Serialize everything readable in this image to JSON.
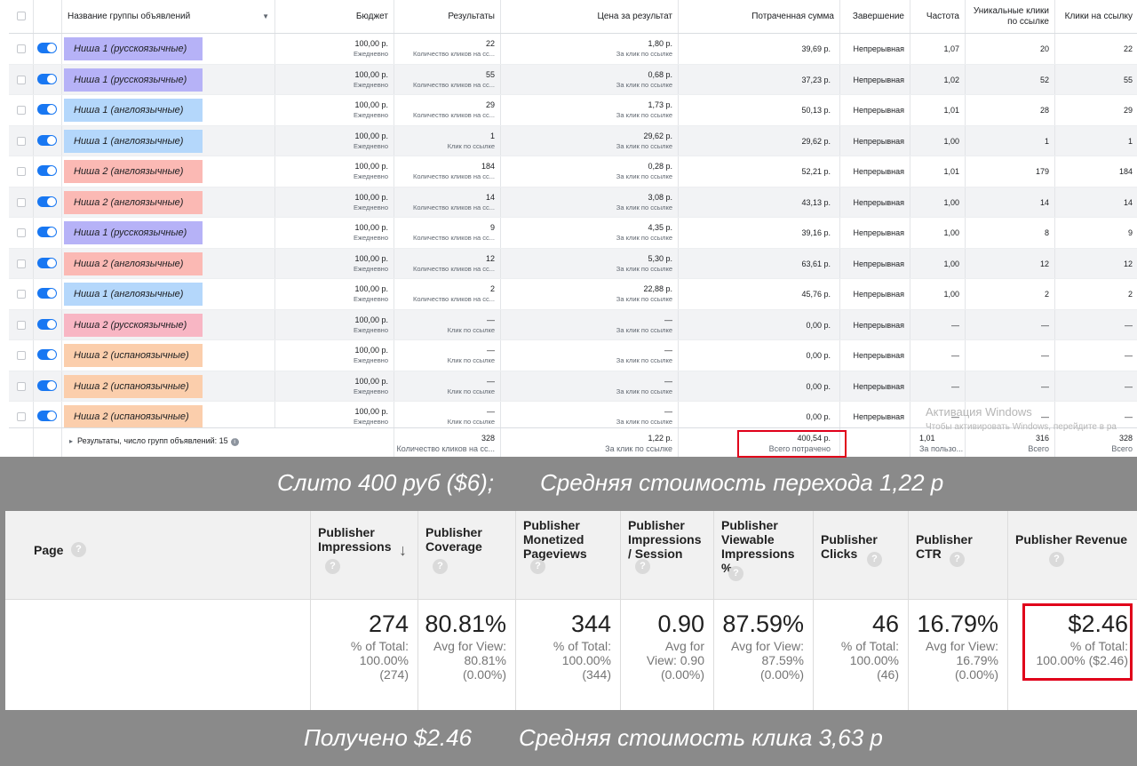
{
  "fb": {
    "headers": [
      "Название группы объявлений",
      "Бюджет",
      "Результаты",
      "Цена за результат",
      "Потраченная сумма",
      "Завершение",
      "Частота",
      "Уникальные клики по ссылке",
      "Клики на ссылку"
    ],
    "rows": [
      {
        "name": "Ниша 1 (русскоязычные)",
        "color": "#b6b2f7",
        "budget": "100,00 р.",
        "budget_sub": "Ежедневно",
        "results": "22",
        "results_sub": "Количество кликов на сс...",
        "cpr": "1,80 р.",
        "cpr_sub": "За клик по ссылке",
        "spent": "39,69 р.",
        "end": "Непрерывная",
        "freq": "1,07",
        "uniq": "20",
        "clicks": "22"
      },
      {
        "name": "Ниша 1 (русскоязычные)",
        "color": "#b6b2f7",
        "budget": "100,00 р.",
        "budget_sub": "Ежедневно",
        "results": "55",
        "results_sub": "Количество кликов на сс...",
        "cpr": "0,68 р.",
        "cpr_sub": "За клик по ссылке",
        "spent": "37,23 р.",
        "end": "Непрерывная",
        "freq": "1,02",
        "uniq": "52",
        "clicks": "55"
      },
      {
        "name": "Ниша 1 (англоязычные)",
        "color": "#b4d7fb",
        "budget": "100,00 р.",
        "budget_sub": "Ежедневно",
        "results": "29",
        "results_sub": "Количество кликов на сс...",
        "cpr": "1,73 р.",
        "cpr_sub": "За клик по ссылке",
        "spent": "50,13 р.",
        "end": "Непрерывная",
        "freq": "1,01",
        "uniq": "28",
        "clicks": "29"
      },
      {
        "name": "Ниша 1 (англоязычные)",
        "color": "#b4d7fb",
        "budget": "100,00 р.",
        "budget_sub": "Ежедневно",
        "results": "1",
        "results_sub": "Клик по ссылке",
        "cpr": "29,62 р.",
        "cpr_sub": "За клик по ссылке",
        "spent": "29,62 р.",
        "end": "Непрерывная",
        "freq": "1,00",
        "uniq": "1",
        "clicks": "1"
      },
      {
        "name": "Ниша 2 (англоязычные)",
        "color": "#fbb9b4",
        "budget": "100,00 р.",
        "budget_sub": "Ежедневно",
        "results": "184",
        "results_sub": "Количество кликов на сс...",
        "cpr": "0,28 р.",
        "cpr_sub": "За клик по ссылке",
        "spent": "52,21 р.",
        "end": "Непрерывная",
        "freq": "1,01",
        "uniq": "179",
        "clicks": "184"
      },
      {
        "name": "Ниша 2 (англоязычные)",
        "color": "#fbb9b4",
        "budget": "100,00 р.",
        "budget_sub": "Ежедневно",
        "results": "14",
        "results_sub": "Количество кликов на сс...",
        "cpr": "3,08 р.",
        "cpr_sub": "За клик по ссылке",
        "spent": "43,13 р.",
        "end": "Непрерывная",
        "freq": "1,00",
        "uniq": "14",
        "clicks": "14"
      },
      {
        "name": "Ниша 1 (русскоязычные)",
        "color": "#b6b2f7",
        "budget": "100,00 р.",
        "budget_sub": "Ежедневно",
        "results": "9",
        "results_sub": "Количество кликов на сс...",
        "cpr": "4,35 р.",
        "cpr_sub": "За клик по ссылке",
        "spent": "39,16 р.",
        "end": "Непрерывная",
        "freq": "1,00",
        "uniq": "8",
        "clicks": "9"
      },
      {
        "name": "Ниша 2 (англоязычные)",
        "color": "#fbb9b4",
        "budget": "100,00 р.",
        "budget_sub": "Ежедневно",
        "results": "12",
        "results_sub": "Количество кликов на сс...",
        "cpr": "5,30 р.",
        "cpr_sub": "За клик по ссылке",
        "spent": "63,61 р.",
        "end": "Непрерывная",
        "freq": "1,00",
        "uniq": "12",
        "clicks": "12"
      },
      {
        "name": "Ниша 1 (англоязычные)",
        "color": "#b4d7fb",
        "budget": "100,00 р.",
        "budget_sub": "Ежедневно",
        "results": "2",
        "results_sub": "Количество кликов на сс...",
        "cpr": "22,88 р.",
        "cpr_sub": "За клик по ссылке",
        "spent": "45,76 р.",
        "end": "Непрерывная",
        "freq": "1,00",
        "uniq": "2",
        "clicks": "2"
      },
      {
        "name": "Ниша 2 (русскоязычные)",
        "color": "#f8b6c4",
        "budget": "100,00 р.",
        "budget_sub": "Ежедневно",
        "results": "—",
        "results_sub": "Клик по ссылке",
        "cpr": "—",
        "cpr_sub": "За клик по ссылке",
        "spent": "0,00 р.",
        "end": "Непрерывная",
        "freq": "—",
        "uniq": "—",
        "clicks": "—"
      },
      {
        "name": "Ниша 2 (испаноязычные)",
        "color": "#fbceac",
        "budget": "100,00 р.",
        "budget_sub": "Ежедневно",
        "results": "—",
        "results_sub": "Клик по ссылке",
        "cpr": "—",
        "cpr_sub": "За клик по ссылке",
        "spent": "0,00 р.",
        "end": "Непрерывная",
        "freq": "—",
        "uniq": "—",
        "clicks": "—"
      },
      {
        "name": "Ниша 2 (испаноязычные)",
        "color": "#fbceac",
        "budget": "100,00 р.",
        "budget_sub": "Ежедневно",
        "results": "—",
        "results_sub": "Клик по ссылке",
        "cpr": "—",
        "cpr_sub": "За клик по ссылке",
        "spent": "0,00 р.",
        "end": "Непрерывная",
        "freq": "—",
        "uniq": "—",
        "clicks": "—"
      },
      {
        "name": "Ниша 2 (испаноязычные)",
        "color": "#fbceac",
        "budget": "100,00 р.",
        "budget_sub": "Ежедневно",
        "results": "—",
        "results_sub": "Клик по ссылке",
        "cpr": "—",
        "cpr_sub": "За клик по ссылке",
        "spent": "0,00 р.",
        "end": "Непрерывная",
        "freq": "—",
        "uniq": "—",
        "clicks": "—"
      }
    ],
    "footer": {
      "label": "Результаты, число групп объявлений: 15",
      "results": "328",
      "results_sub": "Количество кликов на сс...",
      "cpr": "1,22 р.",
      "cpr_sub": "За клик по ссылке",
      "spent": "400,54 р.",
      "spent_sub": "Всего потрачено",
      "freq": "1,01",
      "freq_sub": "За пользо...",
      "uniq": "316",
      "uniq_sub": "Всего",
      "clicks": "328",
      "clicks_sub": "Всего"
    },
    "watermark": {
      "line1": "Активация Windows",
      "line2": "Чтобы активировать Windows, перейдите в ра"
    }
  },
  "caption1": {
    "left": "Слито 400 руб ($6);",
    "right": "Средняя стоимость перехода 1,22 р"
  },
  "adsense": {
    "page_label": "Page",
    "columns": [
      {
        "title": "Publisher Impressions",
        "value": "274",
        "sub": "% of Total:\n100.00%\n(274)"
      },
      {
        "title": "Publisher Coverage",
        "value": "80.81%",
        "sub": "Avg for View:\n80.81%\n(0.00%)"
      },
      {
        "title": "Publisher Monetized Pageviews",
        "value": "344",
        "sub": "% of Total:\n100.00%\n(344)"
      },
      {
        "title": "Publisher Impressions / Session",
        "value": "0.90",
        "sub": "Avg for\nView: 0.90\n(0.00%)"
      },
      {
        "title": "Publisher Viewable Impressions %",
        "value": "87.59%",
        "sub": "Avg for View:\n87.59%\n(0.00%)"
      },
      {
        "title": "Publisher Clicks",
        "value": "46",
        "sub": "% of Total:\n100.00%\n(46)"
      },
      {
        "title": "Publisher CTR",
        "value": "16.79%",
        "sub": "Avg for View:\n16.79%\n(0.00%)"
      },
      {
        "title": "Publisher Revenue",
        "value": "$2.46",
        "sub": "% of Total:\n100.00% ($2.46)"
      }
    ],
    "help_icon": "?",
    "sort_icon": "↓"
  },
  "caption2": {
    "left": "Получено $2.46",
    "right": "Средняя стоимость клика 3,63 р"
  },
  "colors": {
    "toggle": "#1877f2",
    "highlight": "#e0001a"
  }
}
